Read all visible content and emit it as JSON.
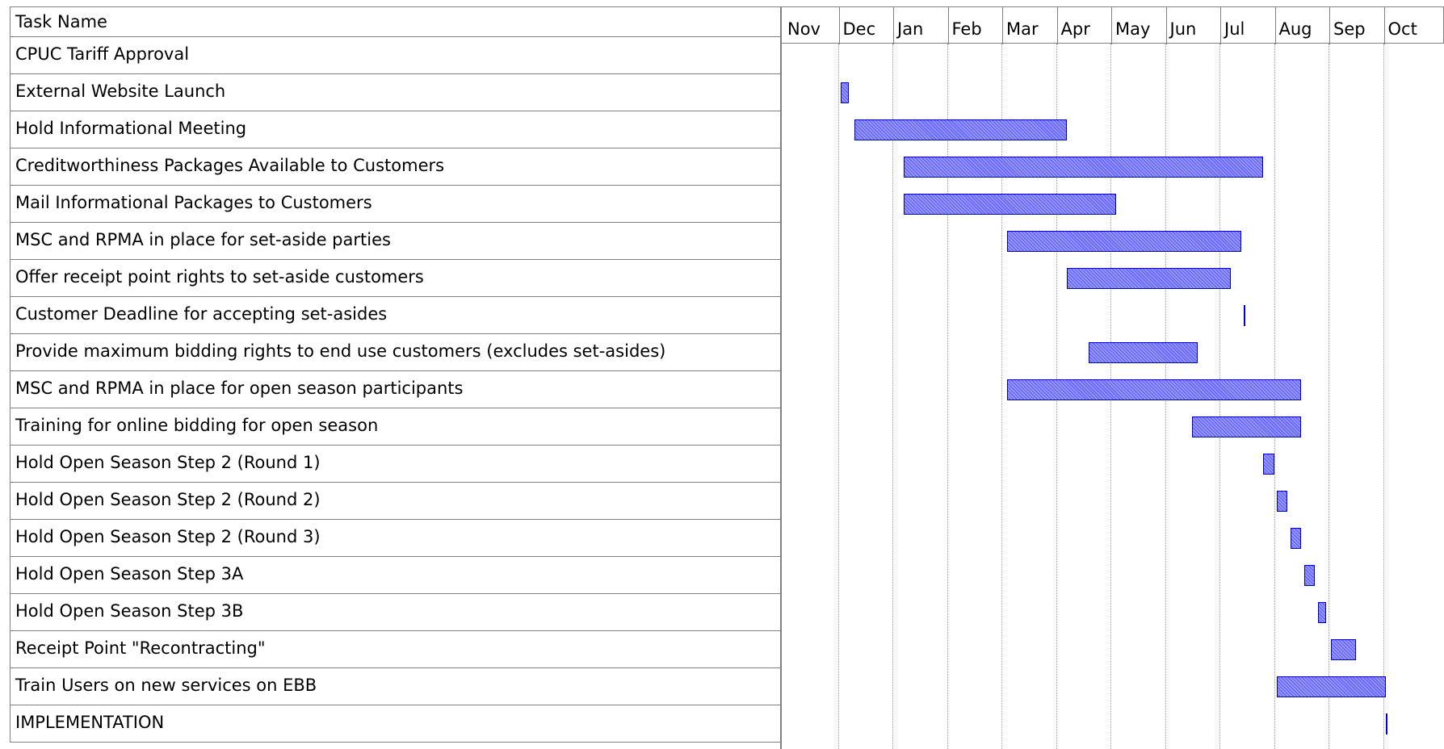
{
  "chart_data": {
    "type": "gantt",
    "table_header": "Task Name",
    "months": [
      "Nov",
      "Dec",
      "Jan",
      "Feb",
      "Mar",
      "Apr",
      "May",
      "Jun",
      "Jul",
      "Aug",
      "Sep",
      "Oct"
    ],
    "tasks": [
      {
        "name": "CPUC Tariff Approval",
        "start": null,
        "end": null
      },
      {
        "name": "External Website Launch",
        "start": 1.05,
        "end": 1.2
      },
      {
        "name": "Hold Informational Meeting",
        "start": 1.3,
        "end": 5.2
      },
      {
        "name": "Creditworthiness Packages Available to Customers",
        "start": 2.2,
        "end": 8.8
      },
      {
        "name": "Mail Informational Packages to Customers",
        "start": 2.2,
        "end": 6.1
      },
      {
        "name": "MSC and RPMA in place for set-aside parties",
        "start": 4.1,
        "end": 8.4
      },
      {
        "name": "Offer receipt point rights to set-aside customers",
        "start": 5.2,
        "end": 8.2
      },
      {
        "name": "Customer Deadline for accepting set-asides",
        "start": 8.45,
        "end": 8.45
      },
      {
        "name": "Provide maximum bidding rights to end use customers (excludes set-asides)",
        "start": 5.6,
        "end": 7.6
      },
      {
        "name": "MSC and RPMA in place for open season participants",
        "start": 4.1,
        "end": 9.5
      },
      {
        "name": "Training for online bidding for open season",
        "start": 7.5,
        "end": 9.5
      },
      {
        "name": "Hold Open Season Step 2 (Round 1)",
        "start": 8.8,
        "end": 9.0
      },
      {
        "name": "Hold Open Season Step 2 (Round 2)",
        "start": 9.05,
        "end": 9.25
      },
      {
        "name": "Hold Open Season Step 2 (Round 3)",
        "start": 9.3,
        "end": 9.5
      },
      {
        "name": "Hold Open Season Step 3A",
        "start": 9.55,
        "end": 9.75
      },
      {
        "name": "Hold Open Season Step 3B",
        "start": 9.8,
        "end": 9.95
      },
      {
        "name": "Receipt Point \"Recontracting\"",
        "start": 10.05,
        "end": 10.5
      },
      {
        "name": "Train Users on new services on EBB",
        "start": 9.05,
        "end": 11.05
      },
      {
        "name": "IMPLEMENTATION",
        "start": 11.05,
        "end": 11.05
      }
    ]
  }
}
